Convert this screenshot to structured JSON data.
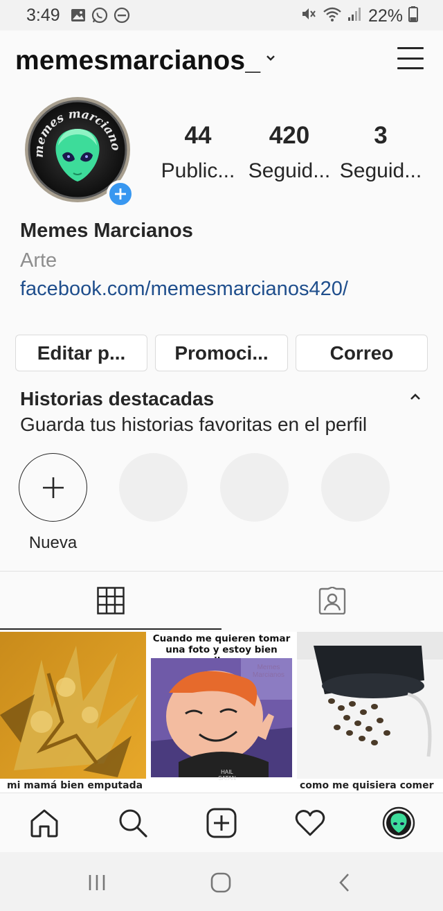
{
  "status_bar": {
    "time": "3:49",
    "battery": "22%",
    "icons": [
      "gallery-icon",
      "whatsapp-icon",
      "dnd-icon",
      "mute-icon",
      "wifi-icon",
      "signal-icon",
      "battery-icon"
    ]
  },
  "header": {
    "username": "memesmarcianos_",
    "icons": [
      "chevron-down-icon",
      "hamburger-menu-icon"
    ]
  },
  "profile": {
    "avatar_text": "memes marcianos",
    "stats": [
      {
        "count": "44",
        "label": "Public..."
      },
      {
        "count": "420",
        "label": "Seguid..."
      },
      {
        "count": "3",
        "label": "Seguid..."
      }
    ],
    "full_name": "Memes Marcianos",
    "category": "Arte",
    "website": "facebook.com/memesmarcianos420/"
  },
  "buttons": {
    "edit": "Editar p...",
    "promote": "Promoci...",
    "email": "Correo"
  },
  "highlights": {
    "title": "Historias destacadas",
    "subtitle": "Guarda tus historias favoritas en el perfil",
    "new_label": "Nueva"
  },
  "tabs": {
    "icons": [
      "grid-icon",
      "tagged-icon"
    ],
    "active": "grid"
  },
  "posts": [
    {
      "caption": "mi mamá bien emputada"
    },
    {
      "caption": "Cuando me quieren tomar una foto y estoy bien marihuana",
      "watermark": "Memes Marcianos",
      "shirt_text": "HAIL SATAN"
    },
    {
      "caption": "como me quisiera comer"
    }
  ],
  "bottom_nav": {
    "icons": [
      "home-icon",
      "search-icon",
      "new-post-icon",
      "activity-heart-icon",
      "profile-avatar-icon"
    ]
  },
  "colors": {
    "accent_blue": "#3897f0",
    "link_blue": "#1f4e8c",
    "muted_gray": "#8e8e8e",
    "text": "#262626"
  }
}
